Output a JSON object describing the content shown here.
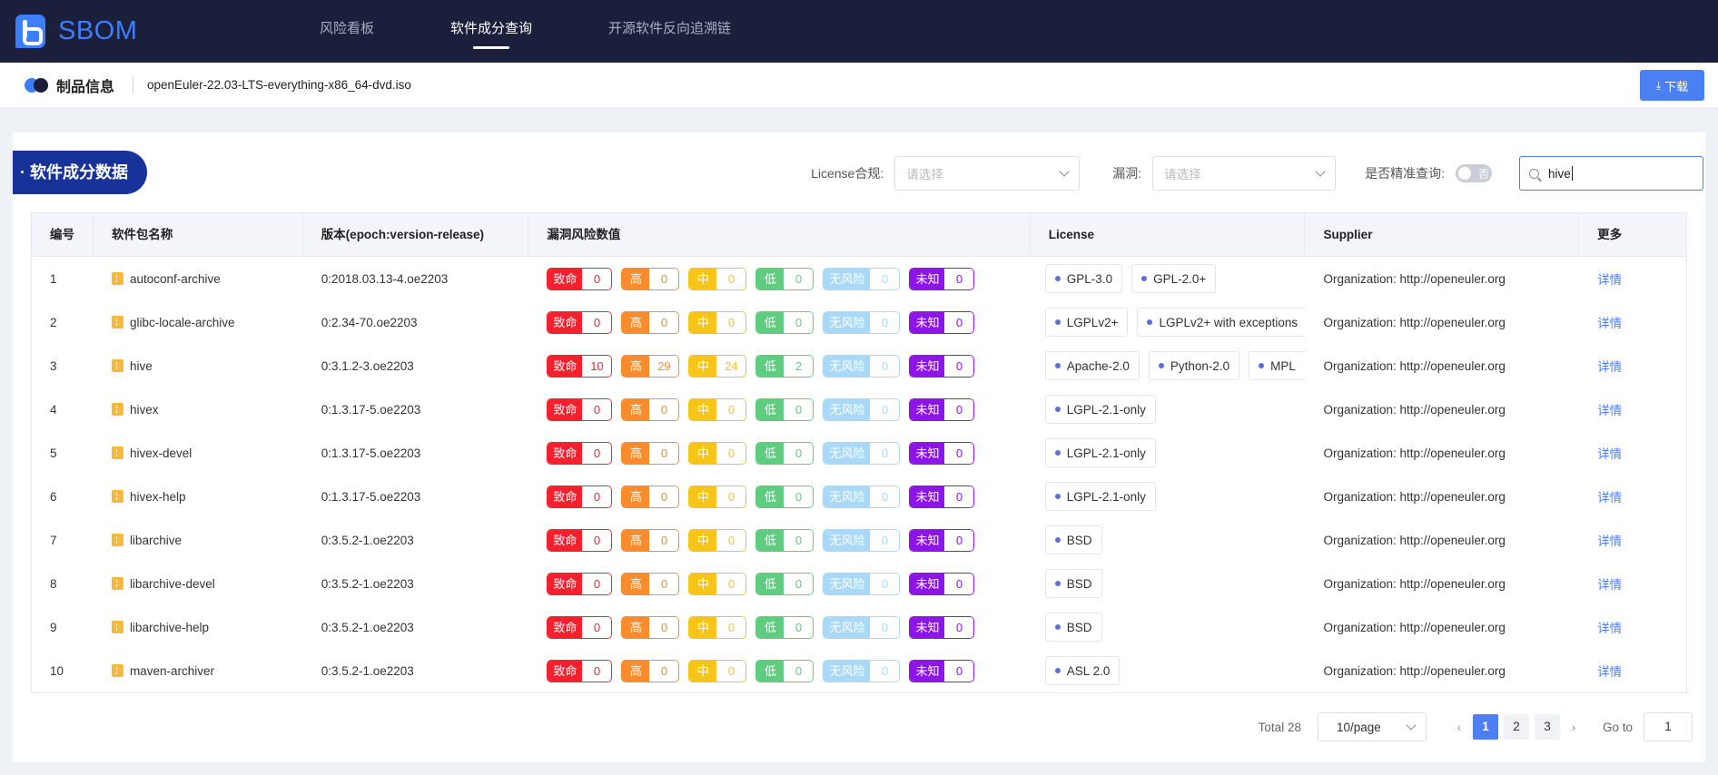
{
  "app": {
    "name": "SBOM"
  },
  "nav": {
    "tabs": [
      {
        "label": "风险看板",
        "active": false
      },
      {
        "label": "软件成分查询",
        "active": true
      },
      {
        "label": "开源软件反向追溯链",
        "active": false
      }
    ]
  },
  "product": {
    "title": "制品信息",
    "name": "openEuler-22.03-LTS-everything-x86_64-dvd.iso",
    "download_label": "下载"
  },
  "section": {
    "title": "· 软件成分数据"
  },
  "filters": {
    "license_label": "License合规:",
    "license_placeholder": "请选择",
    "vuln_label": "漏洞:",
    "vuln_placeholder": "请选择",
    "exact_label": "是否精准查询:",
    "exact_toggle_text": "否",
    "search_value": "hive"
  },
  "table": {
    "headers": [
      "编号",
      "软件包名称",
      "版本(epoch:version-release)",
      "漏洞风险数值",
      "License",
      "Supplier",
      "更多"
    ],
    "risk_labels": [
      "致命",
      "高",
      "中",
      "低",
      "无风险",
      "未知"
    ],
    "risk_colors": {
      "critical": "#f5212d",
      "high": "#fa8c2d",
      "medium": "#f7c519",
      "low": "#5fcd7f",
      "none": "#a9d9f7",
      "unknown": "#8c16e8"
    },
    "detail_label": "详情",
    "rows": [
      {
        "no": "1",
        "name": "autoconf-archive",
        "version": "0:2018.03.13-4.oe2203",
        "risks": [
          "0",
          "0",
          "0",
          "0",
          "0",
          "0"
        ],
        "licenses": [
          "GPL-3.0",
          "GPL-2.0+"
        ],
        "supplier": "Organization: http://openeuler.org"
      },
      {
        "no": "2",
        "name": "glibc-locale-archive",
        "version": "0:2.34-70.oe2203",
        "risks": [
          "0",
          "0",
          "0",
          "0",
          "0",
          "0"
        ],
        "licenses": [
          "LGPLv2+",
          "LGPLv2+ with exceptions"
        ],
        "supplier": "Organization: http://openeuler.org"
      },
      {
        "no": "3",
        "name": "hive",
        "version": "0:3.1.2-3.oe2203",
        "risks": [
          "10",
          "29",
          "24",
          "2",
          "0",
          "0"
        ],
        "licenses": [
          "Apache-2.0",
          "Python-2.0",
          "MPL"
        ],
        "supplier": "Organization: http://openeuler.org"
      },
      {
        "no": "4",
        "name": "hivex",
        "version": "0:1.3.17-5.oe2203",
        "risks": [
          "0",
          "0",
          "0",
          "0",
          "0",
          "0"
        ],
        "licenses": [
          "LGPL-2.1-only"
        ],
        "supplier": "Organization: http://openeuler.org"
      },
      {
        "no": "5",
        "name": "hivex-devel",
        "version": "0:1.3.17-5.oe2203",
        "risks": [
          "0",
          "0",
          "0",
          "0",
          "0",
          "0"
        ],
        "licenses": [
          "LGPL-2.1-only"
        ],
        "supplier": "Organization: http://openeuler.org"
      },
      {
        "no": "6",
        "name": "hivex-help",
        "version": "0:1.3.17-5.oe2203",
        "risks": [
          "0",
          "0",
          "0",
          "0",
          "0",
          "0"
        ],
        "licenses": [
          "LGPL-2.1-only"
        ],
        "supplier": "Organization: http://openeuler.org"
      },
      {
        "no": "7",
        "name": "libarchive",
        "version": "0:3.5.2-1.oe2203",
        "risks": [
          "0",
          "0",
          "0",
          "0",
          "0",
          "0"
        ],
        "licenses": [
          "BSD"
        ],
        "supplier": "Organization: http://openeuler.org"
      },
      {
        "no": "8",
        "name": "libarchive-devel",
        "version": "0:3.5.2-1.oe2203",
        "risks": [
          "0",
          "0",
          "0",
          "0",
          "0",
          "0"
        ],
        "licenses": [
          "BSD"
        ],
        "supplier": "Organization: http://openeuler.org"
      },
      {
        "no": "9",
        "name": "libarchive-help",
        "version": "0:3.5.2-1.oe2203",
        "risks": [
          "0",
          "0",
          "0",
          "0",
          "0",
          "0"
        ],
        "licenses": [
          "BSD"
        ],
        "supplier": "Organization: http://openeuler.org"
      },
      {
        "no": "10",
        "name": "maven-archiver",
        "version": "0:3.5.2-1.oe2203",
        "risks": [
          "0",
          "0",
          "0",
          "0",
          "0",
          "0"
        ],
        "licenses": [
          "ASL 2.0"
        ],
        "supplier": "Organization: http://openeuler.org"
      }
    ]
  },
  "pagination": {
    "total_label": "Total 28",
    "page_size": "10/page",
    "pages": [
      "1",
      "2",
      "3"
    ],
    "current_page": "1",
    "goto_label": "Go to",
    "goto_value": "1"
  }
}
